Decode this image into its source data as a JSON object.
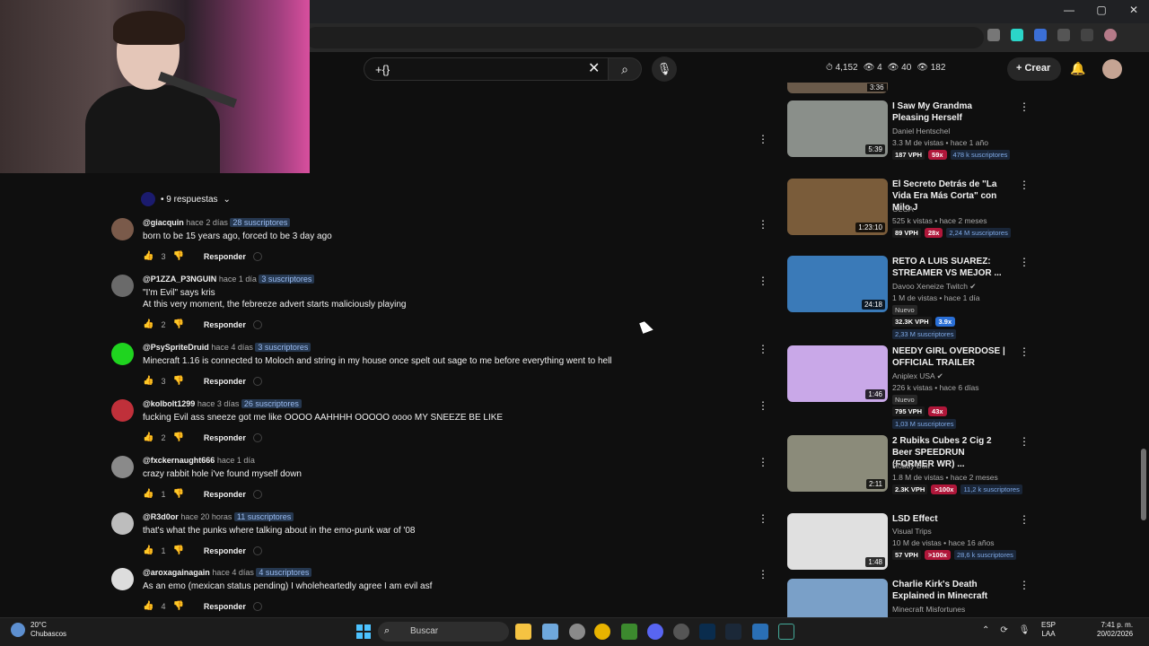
{
  "browser": {
    "window_controls": [
      "—",
      "▢",
      "✕"
    ]
  },
  "header": {
    "search_value": "+{}",
    "clear_icon": "✕",
    "search_icon": "⌕",
    "mic_icon": "🎙",
    "stats": [
      "⏱ 4,152",
      "👁 4",
      "👁 40",
      "👁 182"
    ],
    "create_label": "+ Crear",
    "bell_icon": "🔔"
  },
  "replies_toggle": "• 9 respuestas",
  "comments": [
    {
      "author": "@giacquin",
      "time": "hace 2 días",
      "subs": "28 suscriptores",
      "text": "born to be 15 years ago, forced to be 3 day ago",
      "likes": "3",
      "reply": "Responder",
      "avatar_color": "#7a5a4a"
    },
    {
      "author": "@P1ZZA_P3NGUIN",
      "time": "hace 1 día",
      "subs": "3 suscriptores",
      "text": "\"I'm Evil\" says kris",
      "text2": "At this very moment, the febreeze advert starts maliciously playing",
      "likes": "2",
      "reply": "Responder",
      "avatar_color": "#6a6a6a"
    },
    {
      "author": "@PsySpriteDruid",
      "time": "hace 4 días",
      "subs": "3 suscriptores",
      "text": "Minecraft 1.16 is connected to Moloch and string in my house once spelt out sage to me before everything went to hell",
      "likes": "3",
      "reply": "Responder",
      "avatar_color": "#1fd41f"
    },
    {
      "author": "@kolbolt1299",
      "time": "hace 3 días",
      "subs": "26 suscriptores",
      "text": "fucking Evil ass sneeze got me like OOOO AAHHHH OOOOO oooo MY SNEEZE BE LIKE",
      "likes": "2",
      "reply": "Responder",
      "avatar_color": "#c0303a"
    },
    {
      "author": "@fxckernaught666",
      "time": "hace 1 día",
      "subs": "",
      "text": "crazy rabbit hole i've found myself down",
      "likes": "1",
      "reply": "Responder",
      "avatar_color": "#8a8a8a"
    },
    {
      "author": "@R3d0or",
      "time": "hace 20 horas",
      "subs": "11 suscriptores",
      "text": "that's what the punks where talking about in the emo-punk war of '08",
      "likes": "1",
      "reply": "Responder",
      "avatar_color": "#bdbdbd"
    },
    {
      "author": "@aroxagainagain",
      "time": "hace 4 días",
      "subs": "4 suscriptores",
      "text": "As an emo (mexican status pending) I wholeheartedly agree I am evil asf",
      "likes": "4",
      "reply": "Responder",
      "avatar_color": "#dddddd"
    }
  ],
  "sidebar": {
    "partial_duration": "3:36",
    "videos": [
      {
        "title": "I Saw My Grandma Pleasing Herself",
        "channel": "Daniel Hentschel",
        "meta": "3.3 M de vistas • hace 1 año",
        "duration": "5:39",
        "vph": "187 VPH",
        "mult": "59x",
        "mult_color": "#b0173a",
        "subs": "478 k suscriptores",
        "new": "",
        "thumb": "#8a8f8a"
      },
      {
        "title": "El Secreto Detrás de \"La Vida Era Más Corta\" con Milo J",
        "channel": "OLGA",
        "meta": "525 k vistas • hace 2 meses",
        "duration": "1:23:10",
        "vph": "89 VPH",
        "mult": "28x",
        "mult_color": "#b0173a",
        "subs": "2,24 M suscriptores",
        "new": "",
        "thumb": "#7a5c3a"
      },
      {
        "title": "RETO A LUIS SUAREZ: STREAMER VS MEJOR ...",
        "channel": "Davoo Xeneize Twitch ✔",
        "meta": "1 M de vistas • hace 1 día",
        "duration": "24:18",
        "vph": "32.3K VPH",
        "mult": "3.9x",
        "mult_color": "#2a6fd6",
        "subs": "2,33 M suscriptores",
        "new": "Nuevo",
        "thumb": "#3a7ab8"
      },
      {
        "title": "NEEDY GIRL OVERDOSE | OFFICIAL TRAILER",
        "channel": "Aniplex USA ✔",
        "meta": "226 k vistas • hace 6 días",
        "duration": "1:46",
        "vph": "795 VPH",
        "mult": "43x",
        "mult_color": "#b0173a",
        "subs": "1,03 M suscriptores",
        "new": "Nuevo",
        "thumb": "#c9a8e8"
      },
      {
        "title": "2 Rubiks Cubes 2 Cig 2 Beer SPEEDRUN (FORMER WR) ...",
        "channel": "Robby Bolt",
        "meta": "1.8 M de vistas • hace 2 meses",
        "duration": "2:11",
        "vph": "2.3K VPH",
        "mult": ">100x",
        "mult_color": "#b0173a",
        "subs": "11,2 k suscriptores",
        "new": "",
        "thumb": "#8b8b7a"
      },
      {
        "title": "LSD Effect",
        "channel": "Visual Trips",
        "meta": "10 M de vistas • hace 16 años",
        "duration": "1:48",
        "vph": "57 VPH",
        "mult": ">100x",
        "mult_color": "#b0173a",
        "subs": "28,6 k suscriptores",
        "new": "",
        "thumb": "#e0e0e0"
      },
      {
        "title": "Charlie Kirk's Death Explained in Minecraft",
        "channel": "Minecraft Misfortunes",
        "meta": "",
        "duration": "",
        "vph": "",
        "mult": "",
        "mult_color": "#b0173a",
        "subs": "",
        "new": "",
        "thumb": "#7aa0c8"
      }
    ]
  },
  "taskbar": {
    "weather_temp": "20°C",
    "weather_desc": "Chubascos",
    "search_label": "Buscar",
    "lang1": "ESP",
    "lang2": "LAA",
    "time": "7:41 p. m.",
    "date": "20/02/2026"
  }
}
